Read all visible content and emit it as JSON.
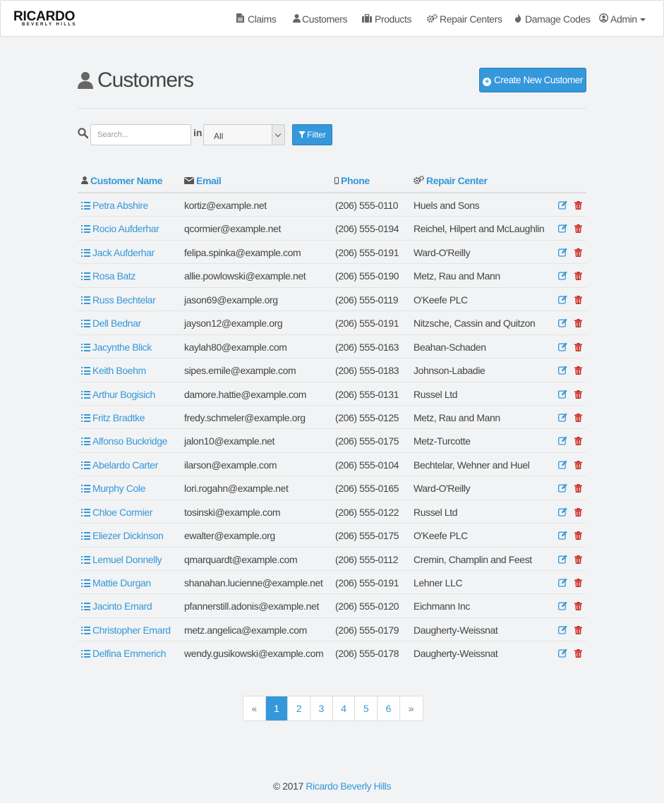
{
  "brand": {
    "name": "RICARDO",
    "tagline": "BEVERLY HILLS"
  },
  "nav": {
    "items": [
      {
        "label": "Claims",
        "icon": "file-icon"
      },
      {
        "label": "Customers",
        "icon": "user-icon"
      },
      {
        "label": "Products",
        "icon": "briefcase-icon"
      },
      {
        "label": "Repair Centers",
        "icon": "gears-icon"
      },
      {
        "label": "Damage Codes",
        "icon": "fire-icon"
      },
      {
        "label": "Admin",
        "icon": "user-circle-icon"
      }
    ]
  },
  "header": {
    "title": "Customers",
    "create_button": "Create New Customer"
  },
  "filter": {
    "search_placeholder": "Search...",
    "in_label": "in",
    "select_value": "All",
    "filter_button": "Filter"
  },
  "table": {
    "columns": [
      "Customer Name",
      "Email",
      "Phone",
      "Repair Center"
    ],
    "rows": [
      {
        "name": "Petra Abshire",
        "email": "kortiz@example.net",
        "phone": "(206) 555-0110",
        "repair_center": "Huels and Sons"
      },
      {
        "name": "Rocio Aufderhar",
        "email": "qcormier@example.net",
        "phone": "(206) 555-0194",
        "repair_center": "Reichel, Hilpert and McLaughlin"
      },
      {
        "name": "Jack Aufderhar",
        "email": "felipa.spinka@example.com",
        "phone": "(206) 555-0191",
        "repair_center": "Ward-O'Reilly"
      },
      {
        "name": "Rosa Batz",
        "email": "allie.powlowski@example.net",
        "phone": "(206) 555-0190",
        "repair_center": "Metz, Rau and Mann"
      },
      {
        "name": "Russ Bechtelar",
        "email": "jason69@example.org",
        "phone": "(206) 555-0119",
        "repair_center": "O'Keefe PLC"
      },
      {
        "name": "Dell Bednar",
        "email": "jayson12@example.org",
        "phone": "(206) 555-0191",
        "repair_center": "Nitzsche, Cassin and Quitzon"
      },
      {
        "name": "Jacynthe Blick",
        "email": "kaylah80@example.com",
        "phone": "(206) 555-0163",
        "repair_center": "Beahan-Schaden"
      },
      {
        "name": "Keith Boehm",
        "email": "sipes.emile@example.com",
        "phone": "(206) 555-0183",
        "repair_center": "Johnson-Labadie"
      },
      {
        "name": "Arthur Bogisich",
        "email": "damore.hattie@example.com",
        "phone": "(206) 555-0131",
        "repair_center": "Russel Ltd"
      },
      {
        "name": "Fritz Bradtke",
        "email": "fredy.schmeler@example.org",
        "phone": "(206) 555-0125",
        "repair_center": "Metz, Rau and Mann"
      },
      {
        "name": "Alfonso Buckridge",
        "email": "jalon10@example.net",
        "phone": "(206) 555-0175",
        "repair_center": "Metz-Turcotte"
      },
      {
        "name": "Abelardo Carter",
        "email": "ilarson@example.com",
        "phone": "(206) 555-0104",
        "repair_center": "Bechtelar, Wehner and Huel"
      },
      {
        "name": "Murphy Cole",
        "email": "lori.rogahn@example.net",
        "phone": "(206) 555-0165",
        "repair_center": "Ward-O'Reilly"
      },
      {
        "name": "Chloe Cormier",
        "email": "tosinski@example.com",
        "phone": "(206) 555-0122",
        "repair_center": "Russel Ltd"
      },
      {
        "name": "Eliezer Dickinson",
        "email": "ewalter@example.org",
        "phone": "(206) 555-0175",
        "repair_center": "O'Keefe PLC"
      },
      {
        "name": "Lemuel Donnelly",
        "email": "qmarquardt@example.com",
        "phone": "(206) 555-0112",
        "repair_center": "Cremin, Champlin and Feest"
      },
      {
        "name": "Mattie Durgan",
        "email": "shanahan.lucienne@example.net",
        "phone": "(206) 555-0191",
        "repair_center": "Lehner LLC"
      },
      {
        "name": "Jacinto Emard",
        "email": "pfannerstill.adonis@example.net",
        "phone": "(206) 555-0120",
        "repair_center": "Eichmann Inc"
      },
      {
        "name": "Christopher Emard",
        "email": "metz.angelica@example.com",
        "phone": "(206) 555-0179",
        "repair_center": "Daugherty-Weissnat"
      },
      {
        "name": "Delfina Emmerich",
        "email": "wendy.gusikowski@example.com",
        "phone": "(206) 555-0178",
        "repair_center": "Daugherty-Weissnat"
      }
    ]
  },
  "pagination": {
    "prev": "«",
    "pages": [
      "1",
      "2",
      "3",
      "4",
      "5",
      "6"
    ],
    "active": "1",
    "next": "»"
  },
  "footer": {
    "copyright": "© 2017",
    "link": "Ricardo Beverly Hills"
  },
  "colors": {
    "accent": "#3498db",
    "delete": "#c9302c"
  }
}
